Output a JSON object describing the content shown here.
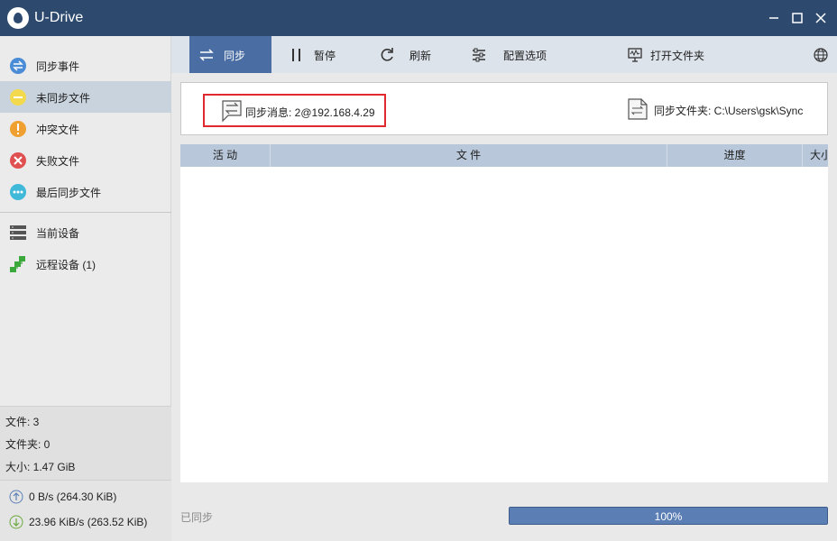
{
  "app": {
    "title": "U-Drive"
  },
  "sidebar": {
    "items": [
      {
        "label": "同步事件",
        "icon": "sync-events-icon",
        "color": "#4a8cd6"
      },
      {
        "label": "未同步文件",
        "icon": "unsynced-icon",
        "color": "#f2d94e"
      },
      {
        "label": "冲突文件",
        "icon": "conflict-icon",
        "color": "#f0a030"
      },
      {
        "label": "失败文件",
        "icon": "failed-icon",
        "color": "#e05050"
      },
      {
        "label": "最后同步文件",
        "icon": "last-synced-icon",
        "color": "#40b8d8"
      }
    ],
    "devices": [
      {
        "label": "当前设备",
        "icon": "server-icon"
      },
      {
        "label": "远程设备 (1)",
        "icon": "network-icon"
      }
    ],
    "stats": {
      "files": "文件: 3",
      "folders": "文件夹: 0",
      "size": "大小:  1.47  GiB"
    },
    "speed": {
      "upload": "0 B/s (264.30 KiB)",
      "download": "23.96 KiB/s (263.52 KiB)"
    }
  },
  "toolbar": {
    "sync": "同步",
    "pause": "暂停",
    "refresh": "刷新",
    "options": "配置选项",
    "open_folder": "打开文件夹"
  },
  "info": {
    "sync_message": "同步消息: 2@192.168.4.29",
    "sync_folder": "同步文件夹: C:\\Users\\gsk\\Sync"
  },
  "table": {
    "columns": [
      "活 动",
      "文 件",
      "进度",
      "大小"
    ]
  },
  "status": {
    "text": "已同步",
    "progress_label": "100%",
    "progress_fraction": 1.0
  },
  "colors": {
    "titlebar": "#2d4a6e",
    "accent": "#4a6ea3",
    "highlight": "#e0282e"
  }
}
